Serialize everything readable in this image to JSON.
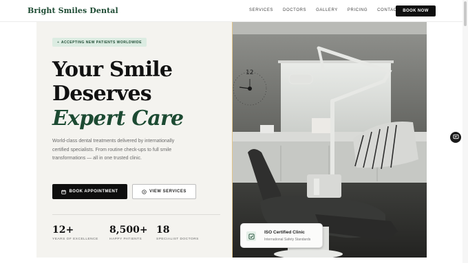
{
  "brand": {
    "name": "Bright Smiles Dental"
  },
  "nav": {
    "links": [
      "SERVICES",
      "DOCTORS",
      "GALLERY",
      "PRICING",
      "CONTACT"
    ],
    "cta": "BOOK NOW"
  },
  "hero": {
    "badge": "ACCEPTING NEW PATIENTS WORLDWIDE",
    "badge_icon": "+",
    "title_line1": "Your Smile",
    "title_line2": "Deserves",
    "title_line3": "Expert Care",
    "description": "World-class dental treatments delivered by internationally certified specialists. From routine check-ups to full smile transformations — all in one trusted clinic.",
    "primary_button": "BOOK APPOINTMENT",
    "secondary_button": "VIEW SERVICES",
    "stats": [
      {
        "value": "12+",
        "label": "YEARS OF EXCELLENCE"
      },
      {
        "value": "8,500+",
        "label": "HAPPY PATIENTS"
      },
      {
        "value": "18",
        "label": "SPECIALIST DOCTORS"
      }
    ]
  },
  "image": {
    "clock_number": "12"
  },
  "certificate": {
    "title": "ISO Certified Clinic",
    "subtitle": "International Safety Standards"
  },
  "colors": {
    "brand_green": "#1c4a32",
    "badge_bg": "#dcece2",
    "panel_bg": "#f4f3ef",
    "dark": "#0e0e0e"
  },
  "icons": {
    "book_button": "calendar-icon",
    "services_button": "circle-arrow-icon",
    "certificate": "check-badge-icon",
    "fab": "chat-icon"
  }
}
